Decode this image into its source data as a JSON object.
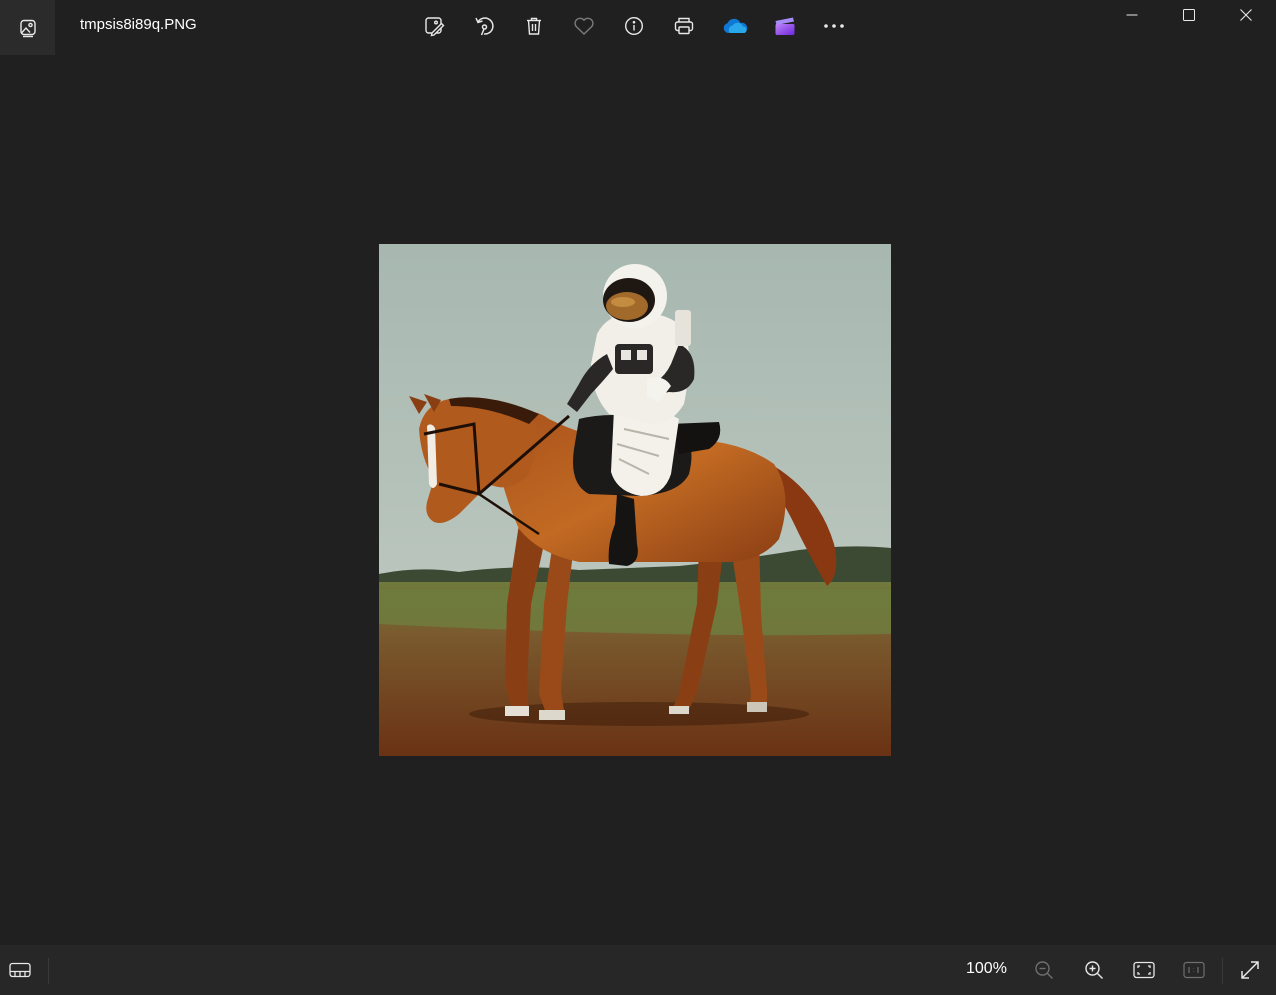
{
  "window": {
    "title": "tmpsis8i89q.PNG",
    "controls": [
      "minimize-icon",
      "maximize-icon",
      "close-icon"
    ]
  },
  "toolbar": {
    "items": [
      "edit-image-icon",
      "rotate-icon",
      "delete-icon",
      "favorite-icon",
      "info-icon",
      "print-icon",
      "onedrive-icon",
      "clipchamp-icon",
      "more-icon"
    ]
  },
  "statusbar": {
    "zoom_label": "100%",
    "items": [
      "filmstrip-icon",
      "zoom-out-icon",
      "zoom-in-icon",
      "fit-to-window-icon",
      "actual-size-icon",
      "fullscreen-icon"
    ]
  },
  "colors": {
    "background": "#202020",
    "statusbar": "#272727",
    "onedrive": "#0f78d4",
    "clipchamp": "#8b5cf6"
  }
}
